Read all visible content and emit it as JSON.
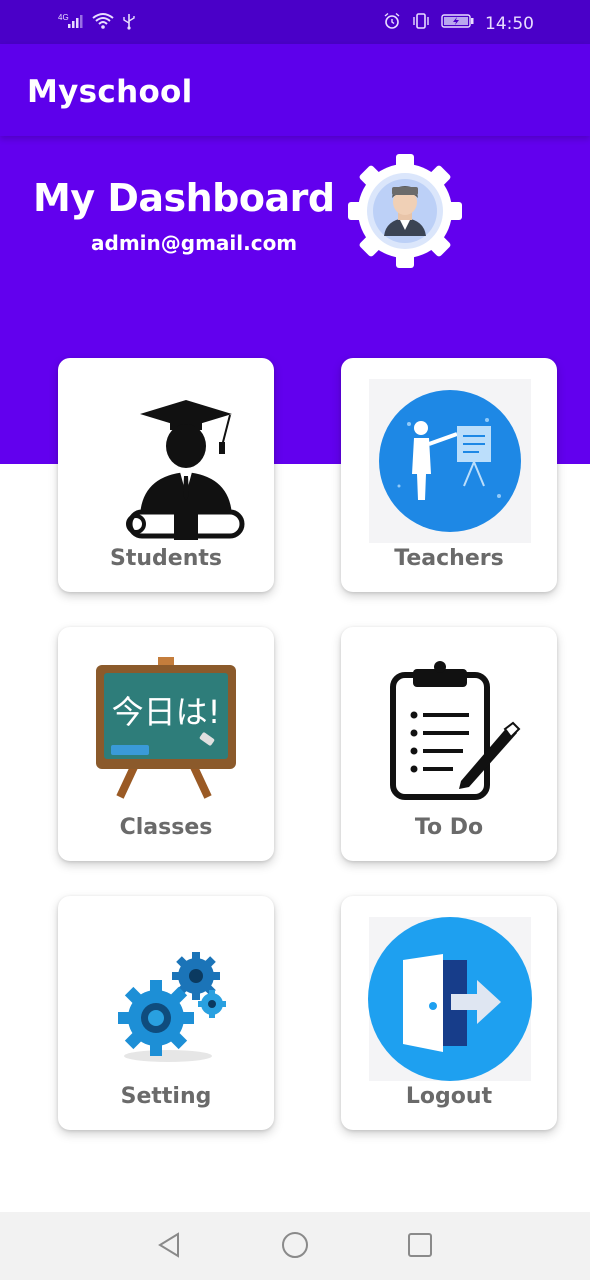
{
  "status_bar": {
    "network": "4G",
    "time": "14:50",
    "icons": [
      "signal-icon",
      "wifi-icon",
      "usb-icon",
      "alarm-icon",
      "vibrate-icon",
      "battery-icon"
    ]
  },
  "app_bar": {
    "title": "Myschool"
  },
  "dashboard": {
    "heading": "My Dashboard",
    "email": "admin@gmail.com"
  },
  "menu": [
    {
      "label": "Students",
      "icon": "graduate-icon"
    },
    {
      "label": "Teachers",
      "icon": "teacher-icon"
    },
    {
      "label": "Classes",
      "icon": "chalkboard-icon"
    },
    {
      "label": "To Do",
      "icon": "clipboard-icon"
    },
    {
      "label": "Setting",
      "icon": "gears-icon"
    },
    {
      "label": "Logout",
      "icon": "logout-door-icon"
    }
  ],
  "chalkboard_text": "今日は!",
  "colors": {
    "primary": "#6200ee",
    "primary_dark": "#4a00c8",
    "label_gray": "#6a6a6a"
  },
  "nav_bar": [
    "back-icon",
    "home-icon",
    "recents-icon"
  ]
}
